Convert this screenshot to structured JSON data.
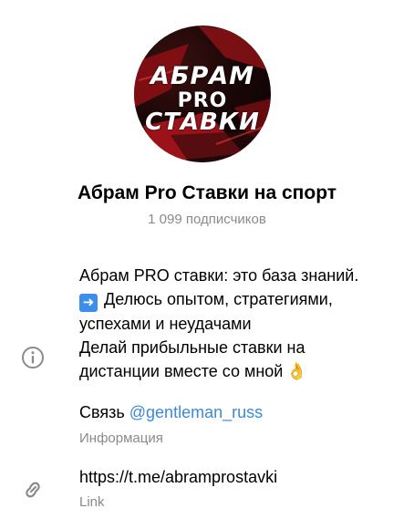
{
  "channel": {
    "avatar_text": {
      "line1": "АБРАМ",
      "line2": "PRO",
      "line3": "СТАВКИ"
    },
    "title": "Абрам Pro Ставки на спорт",
    "subscribers": "1 099 подписчиков"
  },
  "info": {
    "icon": "info-icon",
    "description": {
      "line1": "Абрам PRO ставки: это база знаний.",
      "line2": "Делюсь опытом, стратегиями,",
      "line3": "успехами и неудачами",
      "line4": " Делай прибыльные ставки на",
      "line5": "дистанции вместе со мной"
    },
    "contact_prefix": "Связь",
    "contact_handle": "@gentleman_russ",
    "label": "Информация"
  },
  "link": {
    "icon": "link-icon",
    "url": "https://t.me/abramprostavki",
    "label": "Link"
  },
  "colors": {
    "accent": "#3a8ad8",
    "secondary_text": "#8a8a8a",
    "avatar_red": "#c0141a"
  }
}
